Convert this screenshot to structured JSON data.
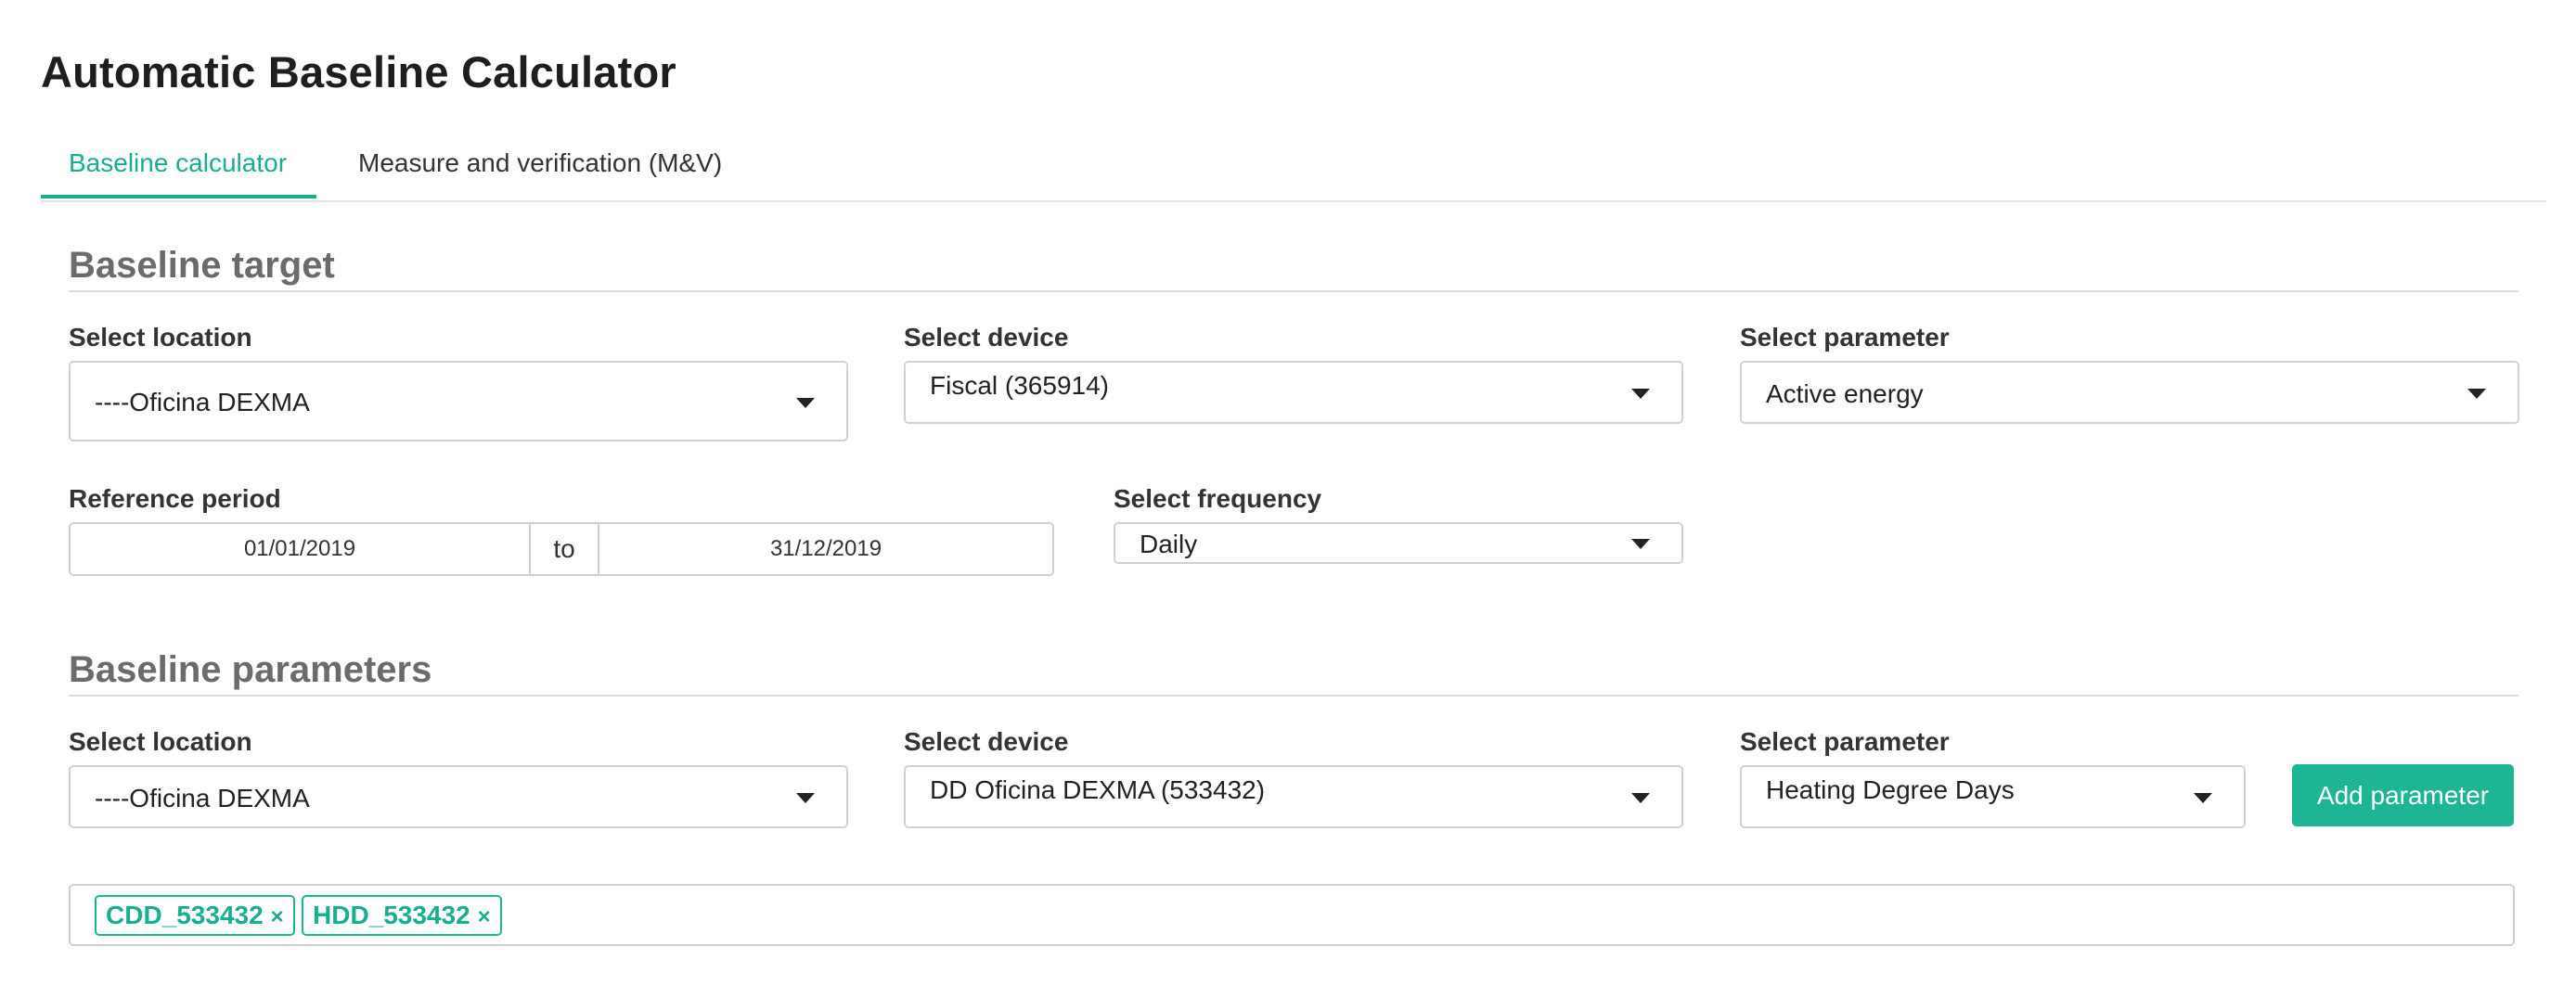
{
  "title": "Automatic Baseline Calculator",
  "tabs": [
    {
      "label": "Baseline calculator",
      "active": true
    },
    {
      "label": "Measure and verification (M&V)",
      "active": false
    }
  ],
  "baseline_target": {
    "heading": "Baseline target",
    "location": {
      "label": "Select location",
      "value": "----Oficina DEXMA"
    },
    "device": {
      "label": "Select device",
      "value": "Fiscal (365914)"
    },
    "parameter": {
      "label": "Select parameter",
      "value": "Active energy"
    },
    "reference_period": {
      "label": "Reference period",
      "from": "01/01/2019",
      "separator": "to",
      "to": "31/12/2019"
    },
    "frequency": {
      "label": "Select frequency",
      "value": "Daily"
    }
  },
  "baseline_parameters": {
    "heading": "Baseline parameters",
    "location": {
      "label": "Select location",
      "value": "----Oficina DEXMA"
    },
    "device": {
      "label": "Select device",
      "value": "DD Oficina DEXMA (533432)"
    },
    "parameter": {
      "label": "Select parameter",
      "value": "Heating Degree Days"
    },
    "add_button": "Add parameter",
    "tags": [
      {
        "label": "CDD_533432",
        "remove": "×"
      },
      {
        "label": "HDD_533432",
        "remove": "×"
      }
    ]
  },
  "colors": {
    "accent": "#1db594",
    "accent_text": "#1aae91",
    "border": "#d2d2d2"
  }
}
